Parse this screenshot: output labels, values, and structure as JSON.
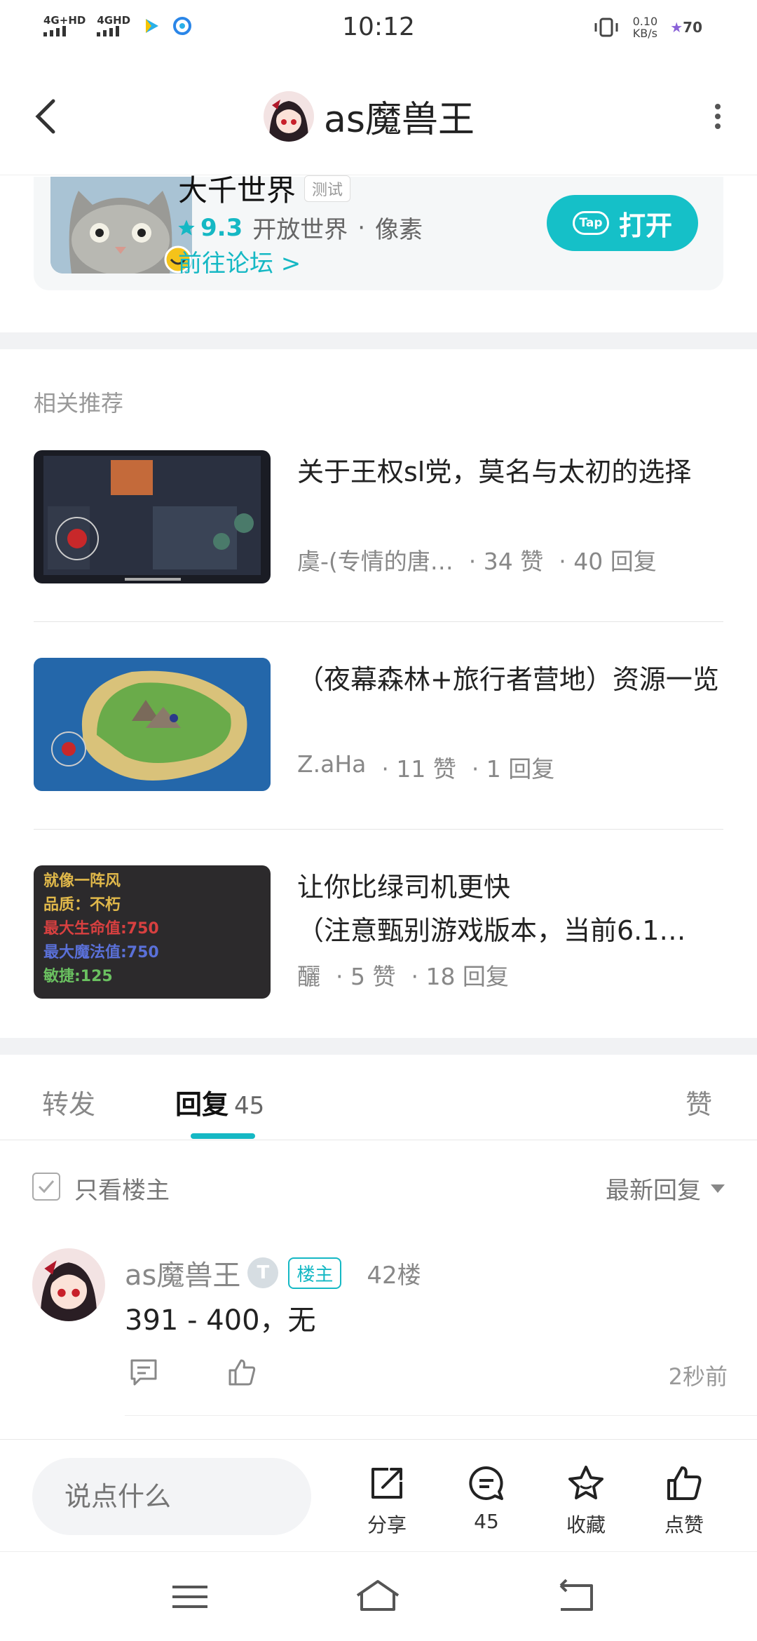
{
  "status_bar": {
    "network1": "4G+HD",
    "network2": "4GHD",
    "time": "10:12",
    "speed_value": "0.10",
    "speed_unit": "KB/s",
    "battery": "70"
  },
  "header": {
    "title": "as魔兽王"
  },
  "game_card": {
    "name": "大千世界",
    "tag": "测试",
    "rating": "9.3",
    "genre1": "开放世界",
    "dot": "·",
    "genre2": "像素",
    "forum_link": "前往论坛 >",
    "open_label": "打开",
    "tap_logo": "Tap"
  },
  "related": {
    "title": "相关推荐",
    "items": [
      {
        "title": "关于王权sl党，莫名与太初的选择",
        "author": "虞-(专情的唐…",
        "likes": "· 34 赞",
        "replies": "· 40 回复"
      },
      {
        "title": "（夜幕森林+旅行者营地）资源一览",
        "author": "Z.aHa",
        "likes": "· 11 赞",
        "replies": "· 1 回复"
      },
      {
        "title": "让你比绿司机更快\n（注意甄别游戏版本，当前6.1…",
        "author": "釃",
        "likes": "· 5 赞",
        "replies": "· 18 回复"
      }
    ],
    "thumb3_lines": [
      "就像一阵风",
      "品质：不朽",
      "最大生命值:750",
      "最大魔法值:750",
      "敏捷:125"
    ]
  },
  "tabs": {
    "forward": "转发",
    "reply": "回复",
    "reply_count": "45",
    "like": "赞"
  },
  "filter": {
    "only_owner": "只看楼主",
    "sort": "最新回复"
  },
  "reply": {
    "name": "as魔兽王",
    "level_badge": "T",
    "owner_badge": "楼主",
    "floor": "42楼",
    "text": "391 - 400，无",
    "time": "2秒前"
  },
  "bottom_bar": {
    "input_placeholder": "说点什么",
    "share": "分享",
    "comment_count": "45",
    "favorite": "收藏",
    "like": "点赞"
  },
  "colors": {
    "accent": "#15b8c4",
    "band": "#f1f2f4"
  }
}
